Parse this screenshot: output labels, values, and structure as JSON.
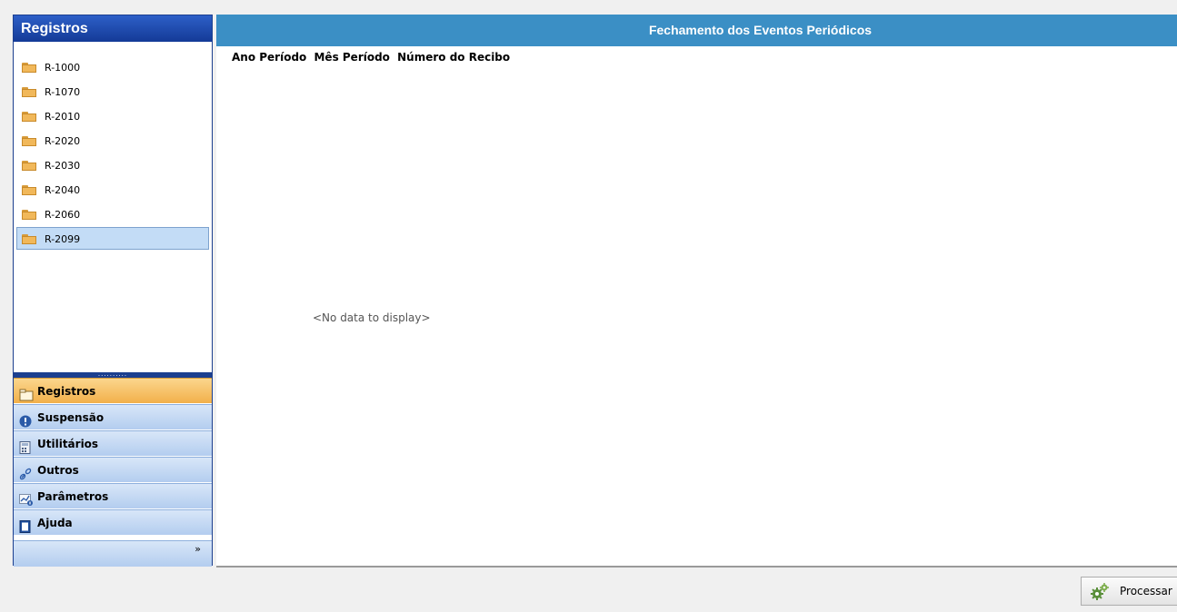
{
  "nav": {
    "title": "Registros",
    "tree_items": [
      {
        "label": "R-1000"
      },
      {
        "label": "R-1070"
      },
      {
        "label": "R-2010"
      },
      {
        "label": "R-2020"
      },
      {
        "label": "R-2030"
      },
      {
        "label": "R-2040"
      },
      {
        "label": "R-2060"
      },
      {
        "label": "R-2099",
        "selected": true
      }
    ],
    "splitter_grip": "..........",
    "buttons": [
      {
        "label": "Registros",
        "icon": "folder-icon",
        "active": true
      },
      {
        "label": "Suspensão",
        "icon": "info-icon"
      },
      {
        "label": "Utilitários",
        "icon": "calculator-icon"
      },
      {
        "label": "Outros",
        "icon": "link-icon"
      },
      {
        "label": "Parâmetros",
        "icon": "chart-params-icon"
      },
      {
        "label": "Ajuda",
        "icon": "book-icon"
      }
    ],
    "overflow_glyph": "»"
  },
  "main": {
    "title": "Fechamento dos Eventos Periódicos",
    "columns": [
      "Ano Período",
      "Mês Período",
      "Número do Recibo"
    ],
    "empty_text": "<No data to display>"
  },
  "footer": {
    "process_label": "Processar"
  },
  "colors": {
    "nav_header": "#143a97",
    "main_header": "#3b8fc5",
    "active_button": "#f2b04a",
    "selected_item": "#c3dcf6"
  }
}
